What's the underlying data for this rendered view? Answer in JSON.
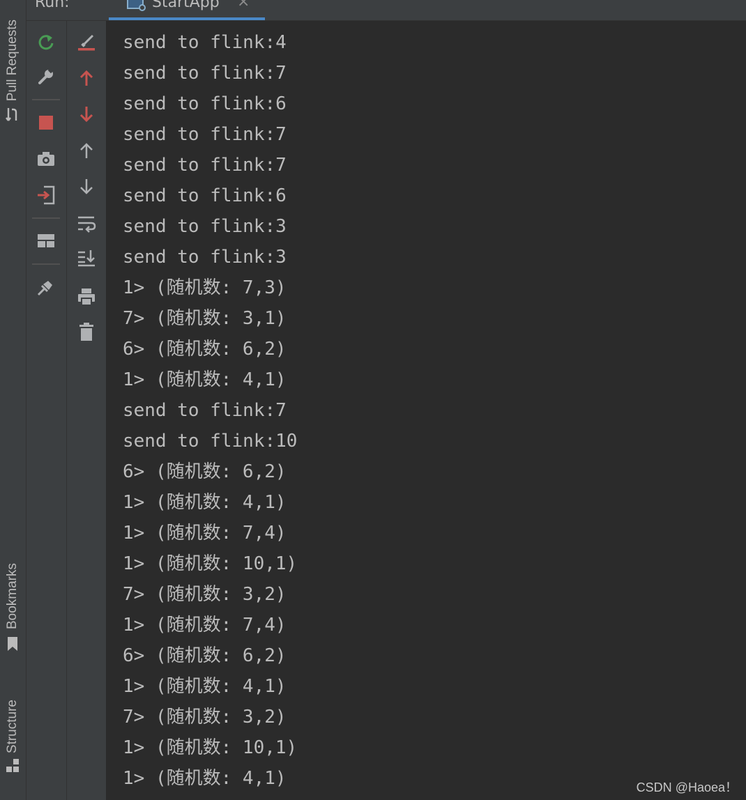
{
  "run_panel": {
    "label": "Run:",
    "tab_title": "StartApp",
    "tab_close": "×"
  },
  "side_tabs": {
    "pull_requests": "Pull Requests",
    "bookmarks": "Bookmarks",
    "structure": "Structure"
  },
  "toolbar_left": [
    {
      "name": "rerun-icon"
    },
    {
      "name": "modify-config-icon"
    },
    {
      "name": "stop-icon"
    },
    {
      "name": "thread-dump-icon"
    },
    {
      "name": "exit-icon"
    },
    {
      "name": "layout-icon"
    },
    {
      "name": "pin-icon"
    }
  ],
  "toolbar_right": [
    {
      "name": "clear-highlight-icon"
    },
    {
      "name": "prev-error-icon"
    },
    {
      "name": "next-error-icon"
    },
    {
      "name": "up-stack-icon"
    },
    {
      "name": "down-stack-icon"
    },
    {
      "name": "soft-wrap-icon"
    },
    {
      "name": "scroll-to-end-icon"
    },
    {
      "name": "print-icon"
    },
    {
      "name": "clear-all-icon"
    }
  ],
  "console": {
    "lines": [
      "send to flink:4",
      "send to flink:7",
      "send to flink:6",
      "send to flink:7",
      "send to flink:7",
      "send to flink:6",
      "send to flink:3",
      "send to flink:3",
      "1> (随机数: 7,3)",
      "7> (随机数: 3,1)",
      "6> (随机数: 6,2)",
      "1> (随机数: 4,1)",
      "send to flink:7",
      "send to flink:10",
      "6> (随机数: 6,2)",
      "1> (随机数: 4,1)",
      "1> (随机数: 7,4)",
      "1> (随机数: 10,1)",
      "7> (随机数: 3,2)",
      "1> (随机数: 7,4)",
      "6> (随机数: 6,2)",
      "1> (随机数: 4,1)",
      "7> (随机数: 3,2)",
      "1> (随机数: 10,1)",
      "1> (随机数: 4,1)"
    ]
  },
  "watermark": "CSDN @Haoea！",
  "colors": {
    "background": "#2b2b2b",
    "panel": "#3c3f41",
    "text": "#bbbbbb",
    "accent_blue": "#4a88c7",
    "red": "#c75450",
    "green": "#499c54"
  }
}
